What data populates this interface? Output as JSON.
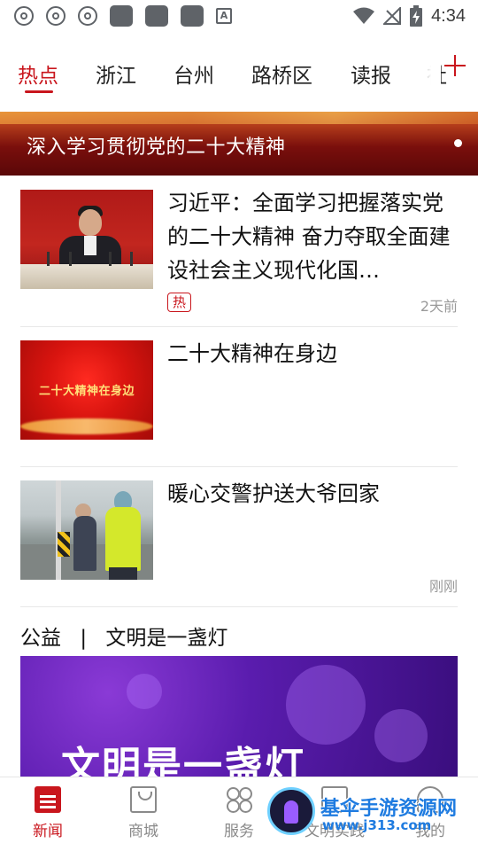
{
  "statusbar": {
    "time": "4:34"
  },
  "tabs": {
    "items": [
      "热点",
      "浙江",
      "台州",
      "路桥区",
      "读报",
      "社"
    ],
    "active_index": 0
  },
  "banner": {
    "text": "深入学习贯彻党的二十大精神"
  },
  "news": [
    {
      "title": "习近平：全面学习把握落实党的二十大精神 奋力夺取全面建设社会主义现代化国…",
      "tag": "热",
      "time": "2天前",
      "thumb_text": ""
    },
    {
      "title": "二十大精神在身边",
      "tag": "",
      "time": "",
      "thumb_text": "二十大精神在身边"
    },
    {
      "title": "暖心交警护送大爷回家",
      "tag": "",
      "time": "刚刚",
      "thumb_text": ""
    }
  ],
  "public_welfare": {
    "label": "公益",
    "separator": "|",
    "subtitle": "文明是一盏灯",
    "banner_text": "文明是一盏灯"
  },
  "bottom_nav": {
    "items": [
      {
        "label": "新闻",
        "icon": "news-icon"
      },
      {
        "label": "商城",
        "icon": "shopping-bag-icon"
      },
      {
        "label": "服务",
        "icon": "service-grid-icon"
      },
      {
        "label": "文明实践",
        "icon": "civilization-icon"
      },
      {
        "label": "我的",
        "icon": "profile-icon"
      }
    ],
    "active_index": 0
  },
  "watermark": {
    "title": "基伞手游资源网",
    "url": "www.j313.com"
  },
  "colors": {
    "accent": "#c9161d",
    "text": "#111111",
    "muted": "#9a9a9a"
  }
}
